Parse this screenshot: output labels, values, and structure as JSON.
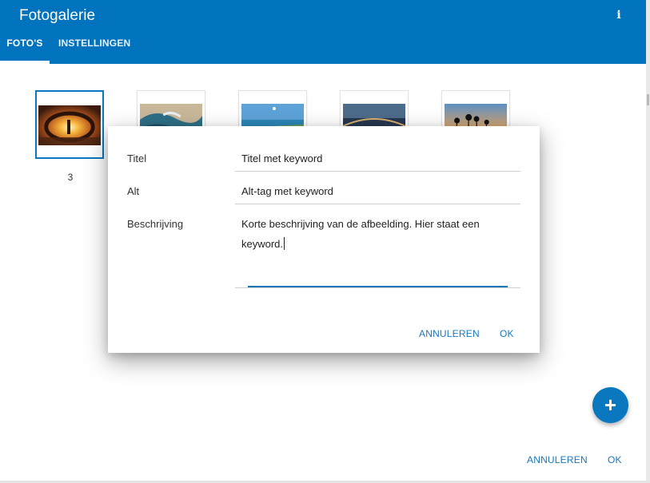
{
  "header": {
    "title": "Fotogalerie",
    "info_glyph": "i",
    "color": "#0073be"
  },
  "tabs": [
    {
      "label": "FOTO'S",
      "active": true
    },
    {
      "label": "INSTELLINGEN",
      "active": false
    }
  ],
  "gallery": {
    "selected_label": "3",
    "thumbnails": [
      {
        "icon": "sunset-sculpture-photo",
        "selected": true
      },
      {
        "icon": "ocean-wave-photo",
        "selected": false
      },
      {
        "icon": "beach-coast-photo",
        "selected": false
      },
      {
        "icon": "city-bridge-night-photo",
        "selected": false
      },
      {
        "icon": "palm-trees-sunset-photo",
        "selected": false
      }
    ]
  },
  "dialog": {
    "title_label": "Titel",
    "title_value": "Titel met keyword",
    "alt_label": "Alt",
    "alt_value": "Alt-tag met keyword",
    "description_label": "Beschrijving",
    "description_value": "Korte beschrijving van de afbeelding. Hier staat een keyword.",
    "cancel_label": "ANNULEREN",
    "ok_label": "OK"
  },
  "fab": {
    "glyph": "+",
    "icon": "plus-icon"
  },
  "footer": {
    "cancel_label": "ANNULEREN",
    "ok_label": "OK"
  },
  "accent_color": "#1978bc"
}
